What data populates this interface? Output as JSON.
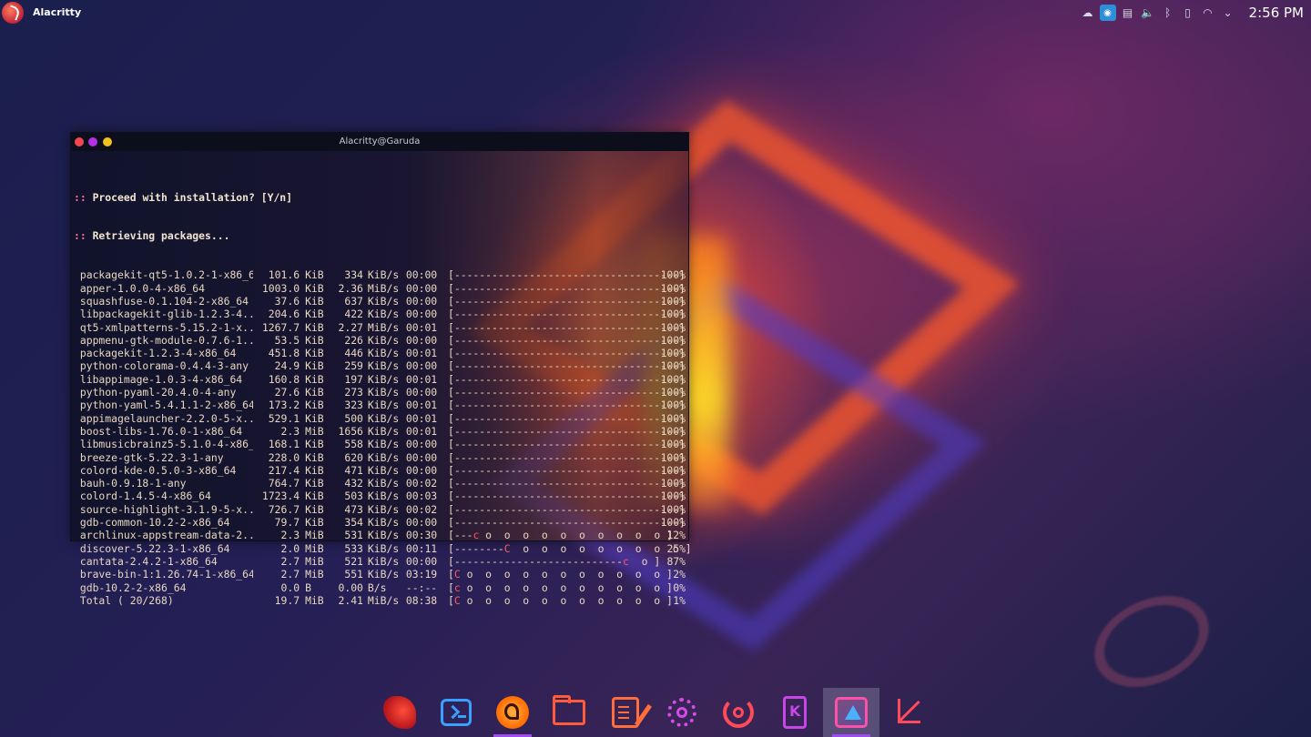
{
  "topbar": {
    "app_title": "Alacritty",
    "clock": "2:56 PM",
    "tray_icons": [
      "steam-icon",
      "shield-icon",
      "clipboard-icon",
      "volume-icon",
      "bluetooth-icon",
      "battery-icon",
      "network-icon",
      "chevron-down-icon"
    ]
  },
  "terminal": {
    "title": "Alacritty@Garuda",
    "prompt_line": "Proceed with installation? [Y/n]",
    "retrieving_line": "Retrieving packages...",
    "rows": [
      {
        "name": "packagekit-qt5-1.0.2-1-x86_64",
        "size": "101.6",
        "unit": "KiB",
        "rate": "334",
        "runit": "KiB/s",
        "eta": "00:00",
        "bar": "[------------------------------------]",
        "pct": "100%"
      },
      {
        "name": "apper-1.0.0-4-x86_64",
        "size": "1003.0",
        "unit": "KiB",
        "rate": "2.36",
        "runit": "MiB/s",
        "eta": "00:00",
        "bar": "[------------------------------------]",
        "pct": "100%"
      },
      {
        "name": "squashfuse-0.1.104-2-x86_64",
        "size": "37.6",
        "unit": "KiB",
        "rate": "637",
        "runit": "KiB/s",
        "eta": "00:00",
        "bar": "[------------------------------------]",
        "pct": "100%"
      },
      {
        "name": "libpackagekit-glib-1.2.3-4...",
        "size": "204.6",
        "unit": "KiB",
        "rate": "422",
        "runit": "KiB/s",
        "eta": "00:00",
        "bar": "[------------------------------------]",
        "pct": "100%"
      },
      {
        "name": "qt5-xmlpatterns-5.15.2-1-x...",
        "size": "1267.7",
        "unit": "KiB",
        "rate": "2.27",
        "runit": "MiB/s",
        "eta": "00:01",
        "bar": "[------------------------------------]",
        "pct": "100%"
      },
      {
        "name": "appmenu-gtk-module-0.7.6-1...",
        "size": "53.5",
        "unit": "KiB",
        "rate": "226",
        "runit": "KiB/s",
        "eta": "00:00",
        "bar": "[------------------------------------]",
        "pct": "100%"
      },
      {
        "name": "packagekit-1.2.3-4-x86_64",
        "size": "451.8",
        "unit": "KiB",
        "rate": "446",
        "runit": "KiB/s",
        "eta": "00:01",
        "bar": "[------------------------------------]",
        "pct": "100%"
      },
      {
        "name": "python-colorama-0.4.4-3-any",
        "size": "24.9",
        "unit": "KiB",
        "rate": "259",
        "runit": "KiB/s",
        "eta": "00:00",
        "bar": "[------------------------------------]",
        "pct": "100%"
      },
      {
        "name": "libappimage-1.0.3-4-x86_64",
        "size": "160.8",
        "unit": "KiB",
        "rate": "197",
        "runit": "KiB/s",
        "eta": "00:01",
        "bar": "[------------------------------------]",
        "pct": "100%"
      },
      {
        "name": "python-pyaml-20.4.0-4-any",
        "size": "27.6",
        "unit": "KiB",
        "rate": "273",
        "runit": "KiB/s",
        "eta": "00:00",
        "bar": "[------------------------------------]",
        "pct": "100%"
      },
      {
        "name": "python-yaml-5.4.1.1-2-x86_64",
        "size": "173.2",
        "unit": "KiB",
        "rate": "323",
        "runit": "KiB/s",
        "eta": "00:01",
        "bar": "[------------------------------------]",
        "pct": "100%"
      },
      {
        "name": "appimagelauncher-2.2.0-5-x...",
        "size": "529.1",
        "unit": "KiB",
        "rate": "500",
        "runit": "KiB/s",
        "eta": "00:01",
        "bar": "[------------------------------------]",
        "pct": "100%"
      },
      {
        "name": "boost-libs-1.76.0-1-x86_64",
        "size": "2.3",
        "unit": "MiB",
        "rate": "1656",
        "runit": "KiB/s",
        "eta": "00:01",
        "bar": "[------------------------------------]",
        "pct": "100%"
      },
      {
        "name": "libmusicbrainz5-5.1.0-4-x86_64",
        "size": "168.1",
        "unit": "KiB",
        "rate": "558",
        "runit": "KiB/s",
        "eta": "00:00",
        "bar": "[------------------------------------]",
        "pct": "100%"
      },
      {
        "name": "breeze-gtk-5.22.3-1-any",
        "size": "228.0",
        "unit": "KiB",
        "rate": "620",
        "runit": "KiB/s",
        "eta": "00:00",
        "bar": "[------------------------------------]",
        "pct": "100%"
      },
      {
        "name": "colord-kde-0.5.0-3-x86_64",
        "size": "217.4",
        "unit": "KiB",
        "rate": "471",
        "runit": "KiB/s",
        "eta": "00:00",
        "bar": "[------------------------------------]",
        "pct": "100%"
      },
      {
        "name": "bauh-0.9.18-1-any",
        "size": "764.7",
        "unit": "KiB",
        "rate": "432",
        "runit": "KiB/s",
        "eta": "00:02",
        "bar": "[------------------------------------]",
        "pct": "100%"
      },
      {
        "name": "colord-1.4.5-4-x86_64",
        "size": "1723.4",
        "unit": "KiB",
        "rate": "503",
        "runit": "KiB/s",
        "eta": "00:03",
        "bar": "[------------------------------------]",
        "pct": "100%"
      },
      {
        "name": "source-highlight-3.1.9-5-x...",
        "size": "726.7",
        "unit": "KiB",
        "rate": "473",
        "runit": "KiB/s",
        "eta": "00:02",
        "bar": "[------------------------------------]",
        "pct": "100%"
      },
      {
        "name": "gdb-common-10.2-2-x86_64",
        "size": "79.7",
        "unit": "KiB",
        "rate": "354",
        "runit": "KiB/s",
        "eta": "00:00",
        "bar": "[------------------------------------]",
        "pct": "100%"
      },
      {
        "name": "archlinux-appstream-data-2...",
        "size": "2.3",
        "unit": "MiB",
        "rate": "531",
        "runit": "KiB/s",
        "eta": "00:30",
        "bar_pre": "[---",
        "bar_pac": "c",
        "bar_post": " o  o  o  o  o  o  o  o  o  o ]",
        "pct": "12%"
      },
      {
        "name": "discover-5.22.3-1-x86_64",
        "size": "2.0",
        "unit": "MiB",
        "rate": "533",
        "runit": "KiB/s",
        "eta": "00:11",
        "bar_pre": "[--------",
        "bar_pac": "C",
        "bar_post": "  o  o  o  o  o  o  o  o  o ]",
        "pct": "25%"
      },
      {
        "name": "cantata-2.4.2-1-x86_64",
        "size": "2.7",
        "unit": "MiB",
        "rate": "521",
        "runit": "KiB/s",
        "eta": "00:00",
        "bar_pre": "[---------------------------",
        "bar_pac": "c",
        "bar_post": "  o ]",
        "pct": "87%"
      },
      {
        "name": "brave-bin-1:1.26.74-1-x86_64",
        "size": "2.7",
        "unit": "MiB",
        "rate": "551",
        "runit": "KiB/s",
        "eta": "03:19",
        "bar_pre": "[",
        "bar_pac": "C",
        "bar_post": " o  o  o  o  o  o  o  o  o  o  o ]",
        "pct": "2%"
      },
      {
        "name": "gdb-10.2-2-x86_64",
        "size": "0.0",
        "unit": "B",
        "rate": "0.00",
        "runit": "B/s",
        "eta": "--:--",
        "bar_pre": "[",
        "bar_pac": "c",
        "bar_post": " o  o  o  o  o  o  o  o  o  o  o ]",
        "pct": "0%"
      },
      {
        "name": "Total ( 20/268)",
        "size": "19.7",
        "unit": "MiB",
        "rate": "2.41",
        "runit": "MiB/s",
        "eta": "08:38",
        "bar_pre": "[",
        "bar_pac": "C",
        "bar_post": " o  o  o  o  o  o  o  o  o  o  o ]",
        "pct": "1%"
      }
    ]
  },
  "dock": {
    "items": [
      {
        "name": "garuda-welcome-icon",
        "cls": "eagle"
      },
      {
        "name": "terminal-icon",
        "cls": "term-ico"
      },
      {
        "name": "garuda-assistant-icon",
        "cls": "garuda",
        "running": true
      },
      {
        "name": "file-manager-icon",
        "cls": "folder"
      },
      {
        "name": "text-editor-icon",
        "cls": "note"
      },
      {
        "name": "settings-icon",
        "cls": "gear"
      },
      {
        "name": "gamer-icon",
        "cls": "target"
      },
      {
        "name": "kde-connect-icon",
        "cls": "kde"
      },
      {
        "name": "software-store-icon",
        "cls": "store",
        "active": true,
        "running": true
      },
      {
        "name": "screenshot-crop-icon",
        "cls": "crop"
      }
    ]
  },
  "colors": {
    "accent": "#a14cf2",
    "close_dot": "#f2474f",
    "max_dot": "#b62fe6",
    "min_dot": "#f3c21c"
  }
}
